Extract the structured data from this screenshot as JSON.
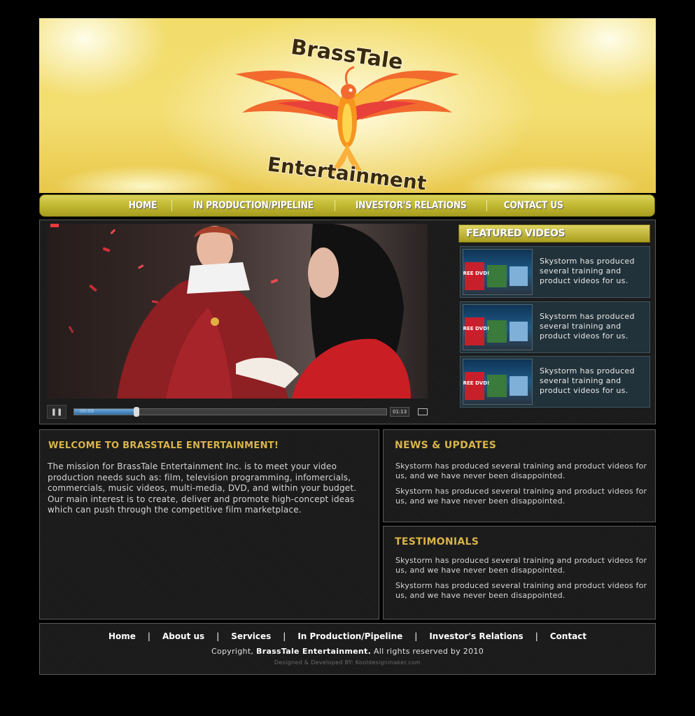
{
  "header": {
    "logo_line1": "BrassTale",
    "logo_line2": "Entertainment"
  },
  "nav": {
    "items": [
      {
        "label": "HOME"
      },
      {
        "label": "IN PRODUCTION/PIPELINE"
      },
      {
        "label": "INVESTOR'S RELATIONS"
      },
      {
        "label": "CONTACT US"
      }
    ]
  },
  "player": {
    "current_time": "00:09",
    "total_time": "01:13",
    "progress": 0.2
  },
  "featured": {
    "title": "FEATURED VIDEOS",
    "items": [
      {
        "text": "Skystorm has produced several training and product videos for us.",
        "thumb_label": "FREE DVD!"
      },
      {
        "text": "Skystorm has produced several training and product videos for us.",
        "thumb_label": "FREE DVD!"
      },
      {
        "text": "Skystorm has produced several training and product videos for us.",
        "thumb_label": "FREE DVD!"
      }
    ]
  },
  "welcome": {
    "title": "WELCOME TO BRASSTALE ENTERTAINMENT!",
    "body": "The mission for BrassTale Entertainment Inc. is to meet your video production needs such as: film, television programming, infomercials, commercials, music videos, multi-media, DVD, and within your budget. Our main interest is to create, deliver and promote high-concept ideas which can push through the competitive film marketplace."
  },
  "news": {
    "title": "NEWS & UPDATES",
    "items": [
      "Skystorm has produced several training and product videos for us, and we have never been disappointed.",
      "Skystorm has produced several training and product videos for us, and we have never been disappointed."
    ]
  },
  "testimonials": {
    "title": "TESTIMONIALS",
    "items": [
      "Skystorm has produced several training and product videos for us, and we have never been disappointed.",
      "Skystorm has produced several training and product videos for us, and we have never been disappointed."
    ]
  },
  "footer": {
    "links": [
      {
        "label": "Home"
      },
      {
        "label": "About us"
      },
      {
        "label": "Services"
      },
      {
        "label": "In Production/Pipeline"
      },
      {
        "label": "Investor's Relations"
      },
      {
        "label": "Contact"
      }
    ],
    "separator": "|",
    "copyright_prefix": "Copyright,",
    "copyright_company": "BrassTale Entertainment.",
    "copyright_suffix": "All rights reserved by 2010",
    "designed_by": "Designed & Developed BY: Kooldesignmaker.com"
  },
  "colors": {
    "accent_gold": "#d9b44a",
    "nav_gold": "#c4bb34",
    "background": "#000000",
    "panel": "#1a1a1a"
  }
}
